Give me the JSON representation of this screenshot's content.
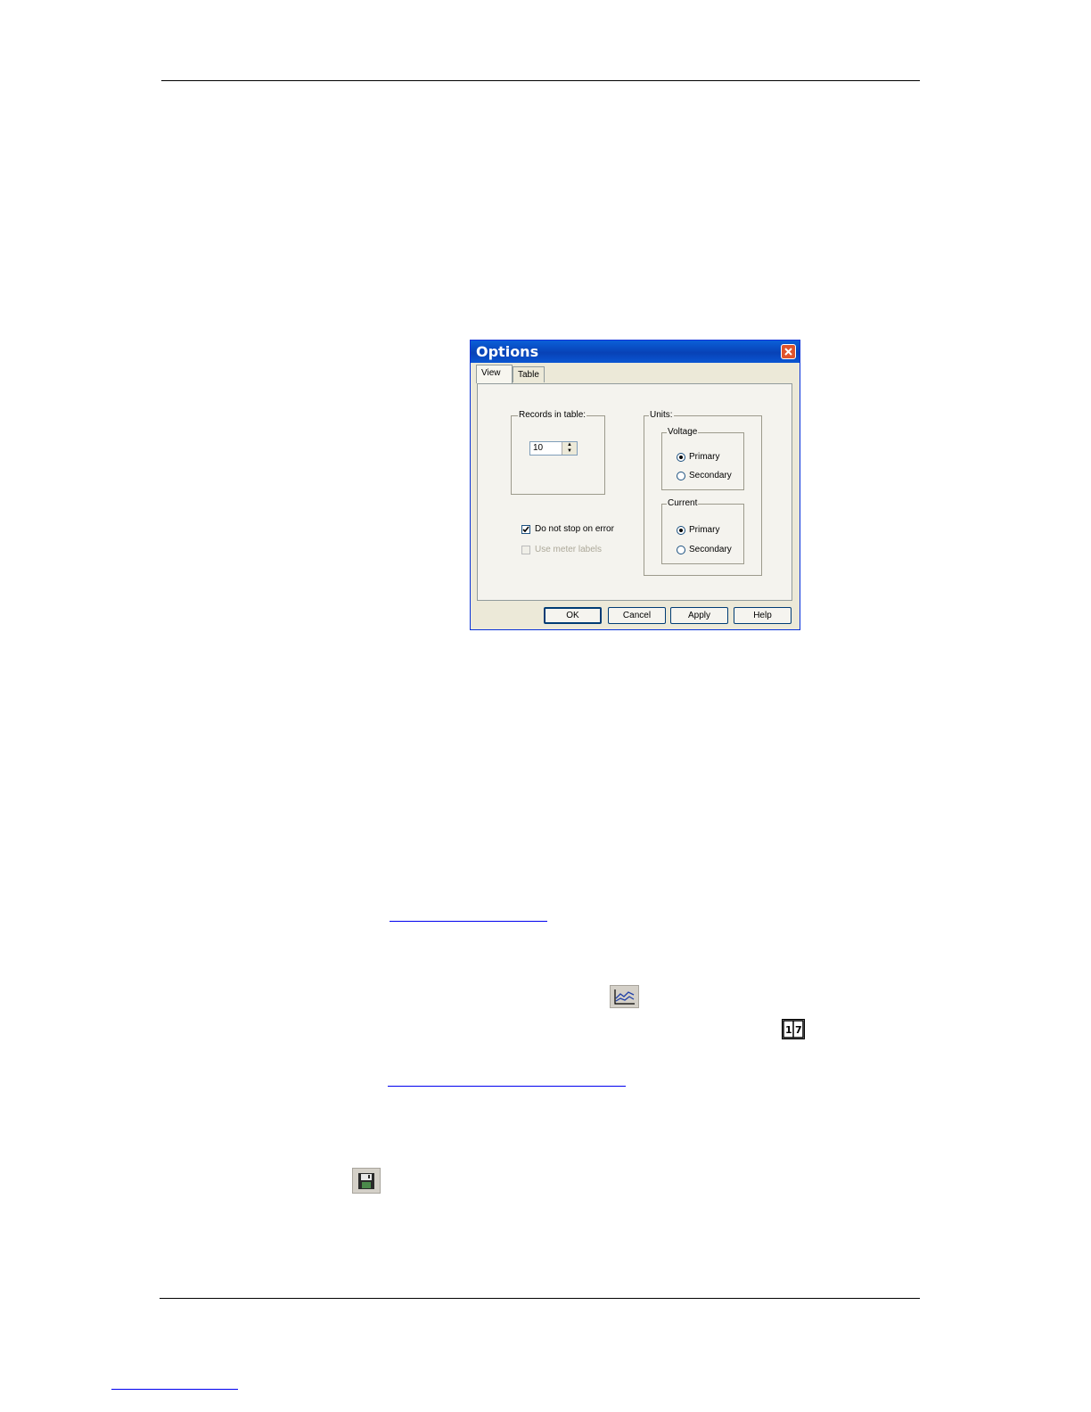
{
  "dialog": {
    "title": "Options",
    "tabs": [
      {
        "label": "View",
        "active": true
      },
      {
        "label": "Table",
        "active": false
      }
    ],
    "records_group_label": "Records in table:",
    "records_value": "10",
    "units_group_label": "Units:",
    "voltage": {
      "label": "Voltage",
      "options": [
        {
          "label": "Primary",
          "checked": true
        },
        {
          "label": "Secondary",
          "checked": false
        }
      ]
    },
    "current": {
      "label": "Current",
      "options": [
        {
          "label": "Primary",
          "checked": true
        },
        {
          "label": "Secondary",
          "checked": false
        }
      ]
    },
    "checkboxes": [
      {
        "label": "Do not stop on error",
        "checked": true,
        "enabled": true
      },
      {
        "label": "Use meter labels",
        "checked": false,
        "enabled": false
      }
    ],
    "buttons": [
      "OK",
      "Cancel",
      "Apply",
      "Help"
    ]
  },
  "icons": [
    {
      "name": "trend-graph-icon"
    },
    {
      "name": "table-view-icon"
    },
    {
      "name": "floppy-disk-save-icon"
    }
  ],
  "colors": {
    "titlebar": "#0842b6",
    "dialog_face": "#ece9d8",
    "close_button": "#e0542c",
    "link": "#0000ee"
  }
}
